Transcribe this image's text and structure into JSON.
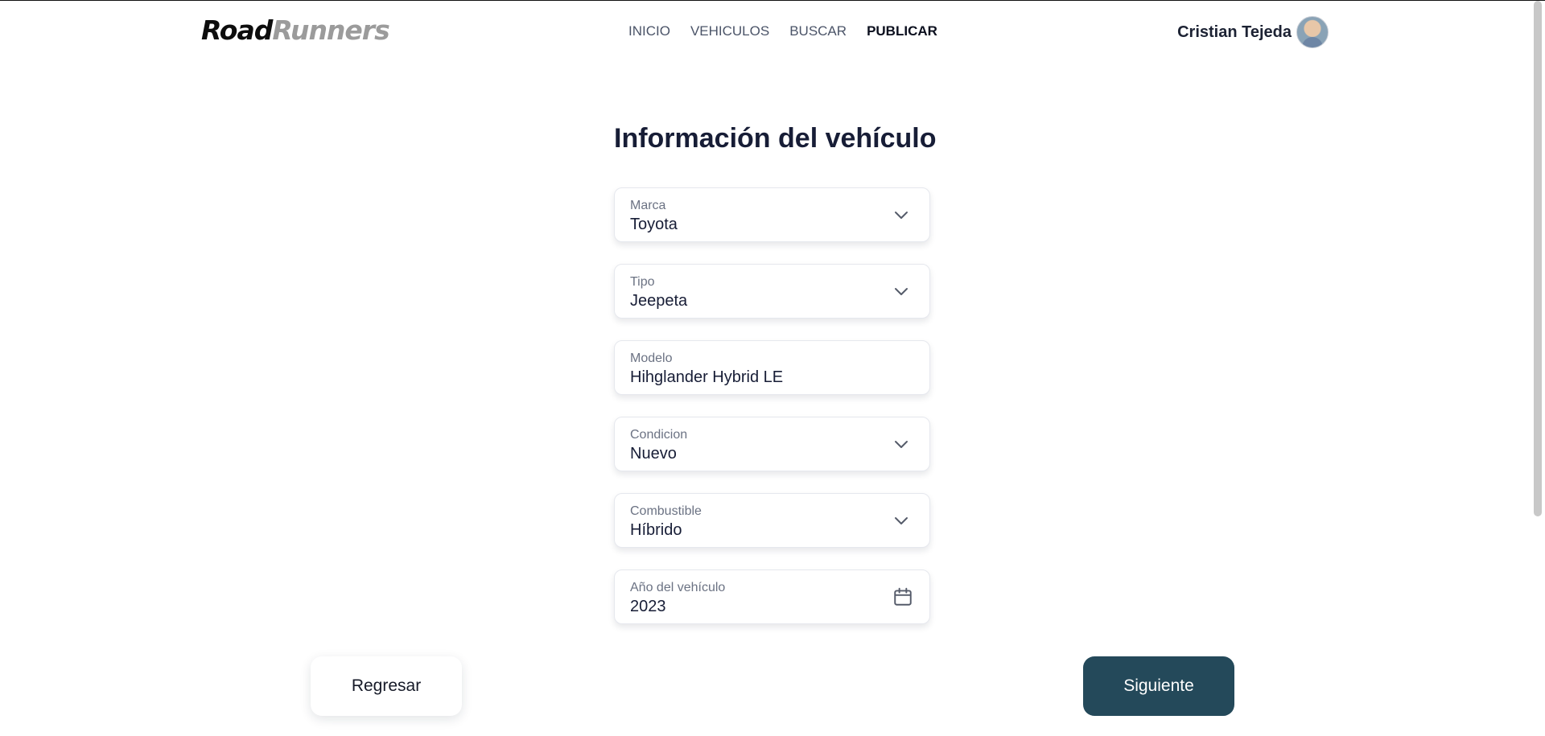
{
  "header": {
    "logo_part1": "Road",
    "logo_part2": "Runners",
    "nav": [
      "INICIO",
      "VEHICULOS",
      "BUSCAR",
      "PUBLICAR"
    ],
    "active_nav": "PUBLICAR",
    "user_name": "Cristian Tejeda"
  },
  "form": {
    "title": "Información del vehículo",
    "fields": {
      "marca": {
        "label": "Marca",
        "value": "Toyota",
        "icon": "chevron-down-icon"
      },
      "tipo": {
        "label": "Tipo",
        "value": "Jeepeta",
        "icon": "chevron-down-icon"
      },
      "modelo": {
        "label": "Modelo",
        "value": "Hihglander Hybrid LE"
      },
      "condicion": {
        "label": "Condicion",
        "value": "Nuevo",
        "icon": "chevron-down-icon"
      },
      "combustible": {
        "label": "Combustible",
        "value": "Híbrido",
        "icon": "chevron-down-icon"
      },
      "anio": {
        "label": "Año del vehículo",
        "value": "2023",
        "icon": "calendar-icon"
      }
    }
  },
  "actions": {
    "back_label": "Regresar",
    "next_label": "Siguiente"
  },
  "colors": {
    "primary_button": "#24495a",
    "title": "#171d36",
    "logo_accent": "#9b9b9b"
  }
}
